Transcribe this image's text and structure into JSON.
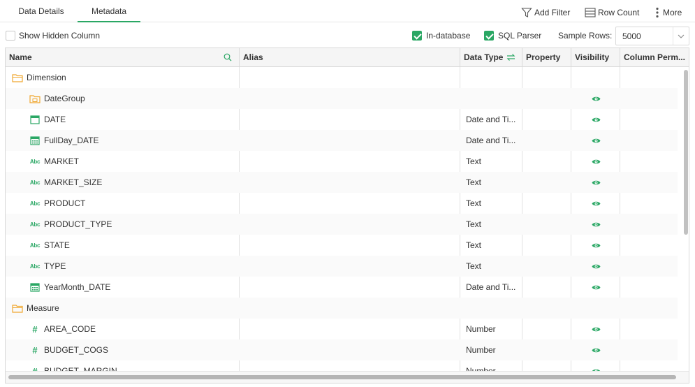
{
  "tabs": [
    {
      "label": "Data Details",
      "active": false
    },
    {
      "label": "Metadata",
      "active": true
    }
  ],
  "toolbar": {
    "add_filter": "Add Filter",
    "row_count": "Row Count",
    "more": "More"
  },
  "options": {
    "show_hidden_column": {
      "label": "Show Hidden Column",
      "checked": false
    },
    "in_database": {
      "label": "In-database",
      "checked": true
    },
    "sql_parser": {
      "label": "SQL Parser",
      "checked": true
    },
    "sample_rows_label": "Sample Rows:",
    "sample_rows_value": "5000"
  },
  "columns": {
    "name": "Name",
    "alias": "Alias",
    "data_type": "Data Type",
    "property": "Property",
    "visibility": "Visibility",
    "column_perm": "Column Perm..."
  },
  "rows": [
    {
      "level": 0,
      "icon": "folder-icon",
      "name": "Dimension",
      "type": "",
      "visible": false
    },
    {
      "level": 1,
      "icon": "date-group-icon",
      "name": "DateGroup",
      "type": "",
      "visible": true
    },
    {
      "level": 1,
      "icon": "date-icon",
      "name": "DATE",
      "type": "Date and Ti...",
      "visible": true
    },
    {
      "level": 1,
      "icon": "calendar-icon",
      "name": "FullDay_DATE",
      "type": "Date and Ti...",
      "visible": true
    },
    {
      "level": 1,
      "icon": "text-type-icon",
      "name": "MARKET",
      "type": "Text",
      "visible": true
    },
    {
      "level": 1,
      "icon": "text-type-icon",
      "name": "MARKET_SIZE",
      "type": "Text",
      "visible": true
    },
    {
      "level": 1,
      "icon": "text-type-icon",
      "name": "PRODUCT",
      "type": "Text",
      "visible": true
    },
    {
      "level": 1,
      "icon": "text-type-icon",
      "name": "PRODUCT_TYPE",
      "type": "Text",
      "visible": true
    },
    {
      "level": 1,
      "icon": "text-type-icon",
      "name": "STATE",
      "type": "Text",
      "visible": true
    },
    {
      "level": 1,
      "icon": "text-type-icon",
      "name": "TYPE",
      "type": "Text",
      "visible": true
    },
    {
      "level": 1,
      "icon": "calendar-icon",
      "name": "YearMonth_DATE",
      "type": "Date and Ti...",
      "visible": true
    },
    {
      "level": 0,
      "icon": "folder-icon",
      "name": "Measure",
      "type": "",
      "visible": false
    },
    {
      "level": 1,
      "icon": "number-type-icon",
      "name": "AREA_CODE",
      "type": "Number",
      "visible": true
    },
    {
      "level": 1,
      "icon": "number-type-icon",
      "name": "BUDGET_COGS",
      "type": "Number",
      "visible": true
    },
    {
      "level": 1,
      "icon": "number-type-icon",
      "name": "BUDGET_MARGIN",
      "type": "Number",
      "visible": true
    }
  ],
  "colors": {
    "accent": "#2aa764",
    "folder": "#f0a830"
  },
  "abc_glyph": "Abc",
  "hash_glyph": "#"
}
